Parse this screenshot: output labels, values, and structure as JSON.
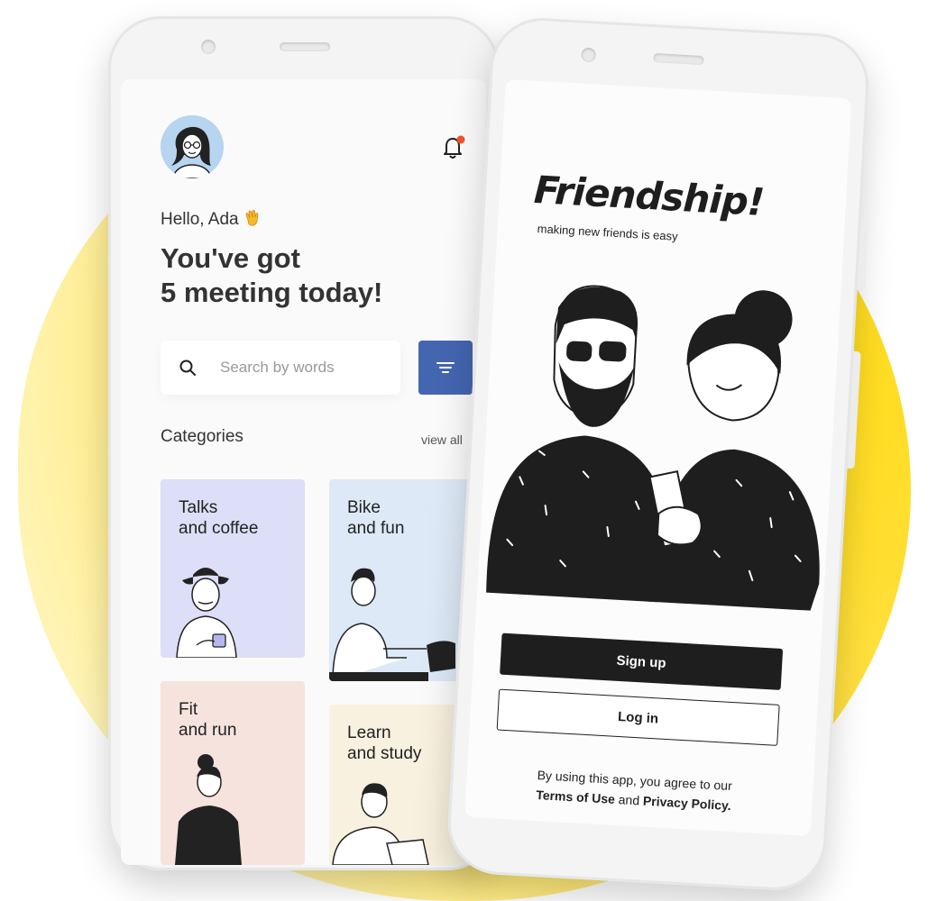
{
  "colors": {
    "accent_yellow": "#ffdc14",
    "brand_blue": "#4466b0",
    "ink": "#1e1e1e"
  },
  "left_app": {
    "greeting": "Hello, Ada",
    "wave_icon": "waving-hand-icon",
    "headline_line1": "You've got",
    "headline_line2": "5 meeting today!",
    "search": {
      "placeholder": "Search by words"
    },
    "categories_title": "Categories",
    "view_all": "view all",
    "cards": [
      {
        "label": "Talks\nand coffee",
        "bg": "#dcdff7"
      },
      {
        "label": "Bike\nand fun",
        "bg": "#dde9f6"
      },
      {
        "label": "Fit\nand run",
        "bg": "#f6e3de"
      },
      {
        "label": "Learn\nand study",
        "bg": "#f8f1df"
      }
    ]
  },
  "right_app": {
    "logo": "Friendship!",
    "tagline": "making new friends is easy",
    "signup_label": "Sign up",
    "login_label": "Log in",
    "terms_prefix": "By using this app, you agree to our",
    "terms_link": "Terms of Use",
    "terms_and": "and",
    "privacy_link": "Privacy Policy."
  }
}
